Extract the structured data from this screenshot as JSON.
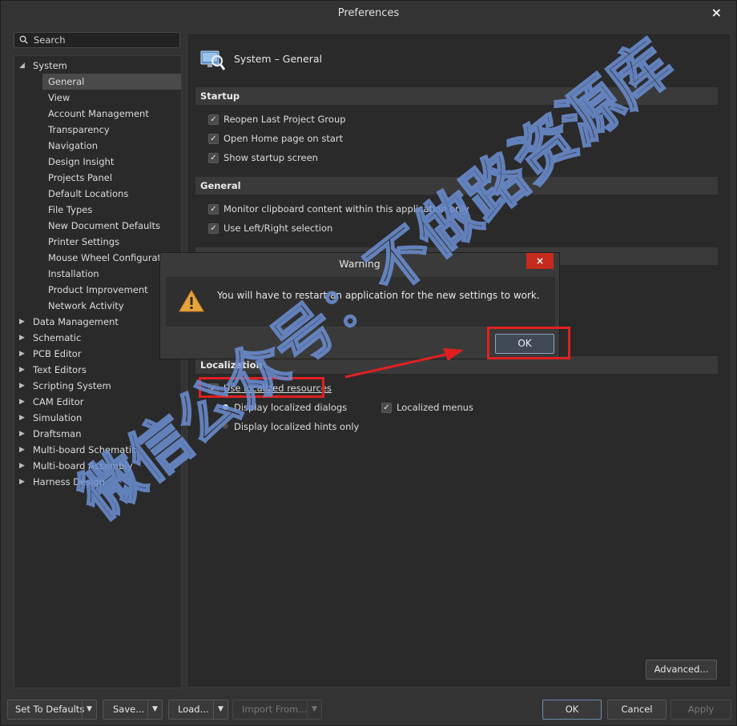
{
  "window": {
    "title": "Preferences",
    "close": "×"
  },
  "search": {
    "placeholder": "Search"
  },
  "tree": {
    "system": "System",
    "system_children": [
      "General",
      "View",
      "Account Management",
      "Transparency",
      "Navigation",
      "Design Insight",
      "Projects Panel",
      "Default Locations",
      "File Types",
      "New Document Defaults",
      "Printer Settings",
      "Mouse Wheel Configuration",
      "Installation",
      "Product Improvement",
      "Network Activity"
    ],
    "selected": "General",
    "groups": [
      "Data Management",
      "Schematic",
      "PCB Editor",
      "Text Editors",
      "Scripting System",
      "CAM Editor",
      "Simulation",
      "Draftsman",
      "Multi-board Schematic",
      "Multi-board Assembly",
      "Harness Design"
    ]
  },
  "panel": {
    "title": "System – General",
    "sections": {
      "startup": "Startup",
      "general": "General",
      "localization": "Localization"
    },
    "startup_options": [
      {
        "label": "Reopen Last Project Group",
        "checked": true
      },
      {
        "label": "Open Home page on start",
        "checked": true
      },
      {
        "label": "Show startup screen",
        "checked": true
      }
    ],
    "general_options": [
      {
        "label": "Monitor clipboard content within this application only",
        "checked": true
      },
      {
        "label": "Use Left/Right selection",
        "checked": true
      }
    ],
    "localization": {
      "use_localized": "Use localized resources",
      "display_dialogs": "Display localized dialogs",
      "display_hints": "Display localized hints only",
      "localized_menus": "Localized menus"
    },
    "advanced": "Advanced..."
  },
  "dialog": {
    "title": "Warning",
    "close": "×",
    "message": "You will have to restart an application for the new settings to work.",
    "ok": "OK"
  },
  "footer": {
    "set_defaults": "Set To Defaults",
    "save": "Save...",
    "load": "Load...",
    "import_from": "Import From...",
    "ok": "OK",
    "cancel": "Cancel",
    "apply": "Apply"
  },
  "watermark": "微信公众号：不做路资源库",
  "colors": {
    "annotation_red": "#e02020",
    "dialog_close": "#c42b1c",
    "watermark_blue": "#6c8fd4"
  }
}
